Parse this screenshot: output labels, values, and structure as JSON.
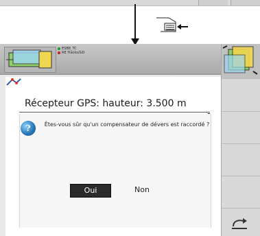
{
  "title_bar": {
    "line1": "ESB8_TC",
    "line2": "RE Tracks/GD"
  },
  "content": {
    "gps_title": "Récepteur GPS: hauteur: 3.500 m"
  },
  "dialog": {
    "question": "Êtes-vous sûr qu'un compensateur de dévers est raccordé ?",
    "yes_label": "Oui",
    "no_label": "Non"
  },
  "icons": {
    "info": "info-icon",
    "back_symbol": "back-arrow-icon",
    "callout": "softkey-callout-icon",
    "bottom_right": "return-icon"
  },
  "colors": {
    "accent_blue": "#2a7ab8",
    "button_dark": "#2b2b2b"
  }
}
